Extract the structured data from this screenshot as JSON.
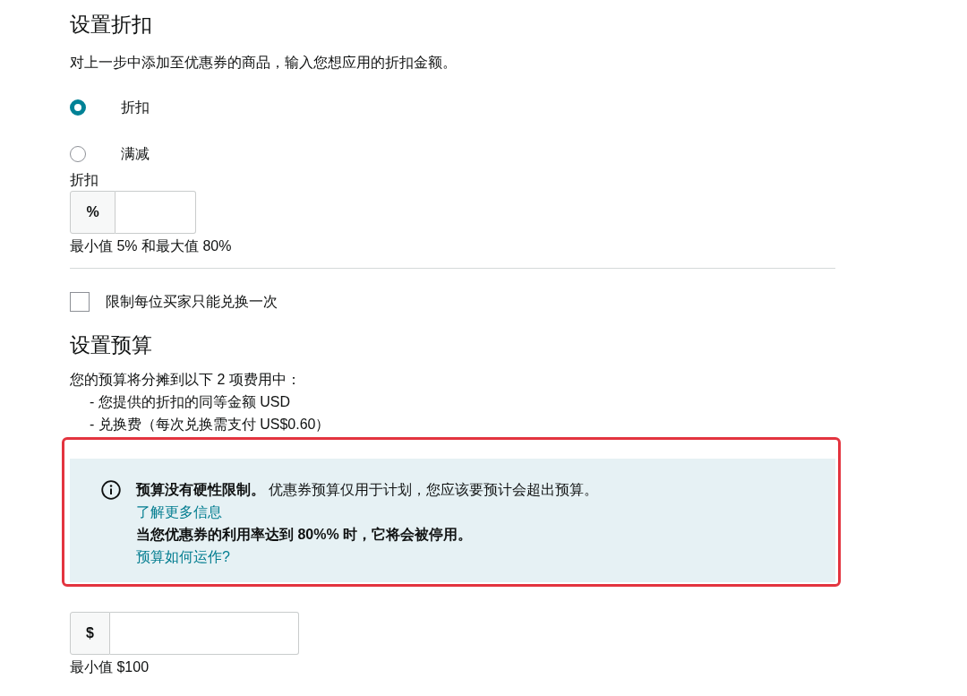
{
  "discount_section": {
    "title": "设置折扣",
    "description": "对上一步中添加至优惠券的商品，输入您想应用的折扣金额。",
    "options": [
      {
        "label": "折扣",
        "selected": true
      },
      {
        "label": "满减",
        "selected": false
      }
    ],
    "field": {
      "label": "折扣",
      "prefix": "%",
      "hint": "最小值 5% 和最大值 80%"
    }
  },
  "limit_checkbox": {
    "label": "限制每位买家只能兑换一次",
    "checked": false
  },
  "budget_section": {
    "title": "设置预算",
    "intro": "您的预算将分摊到以下 2 项费用中：",
    "items": [
      "- 您提供的折扣的同等金额 USD",
      "- 兑换费（每次兑换需支付 US$0.60）"
    ],
    "alert": {
      "highlighted": true,
      "lines": [
        {
          "kind": "text",
          "text": "**预算没有硬性限制。** 优惠券预算仅用于计划，您应该要预计会超出预算。"
        },
        {
          "kind": "link",
          "text": "了解更多信息"
        },
        {
          "kind": "strong",
          "text": "当您优惠券的利用率达到 80%% 时，它将会被停用。"
        },
        {
          "kind": "link",
          "text": "预算如何运作?"
        }
      ]
    },
    "field": {
      "prefix": "$",
      "hint": "最小值 $100"
    }
  }
}
